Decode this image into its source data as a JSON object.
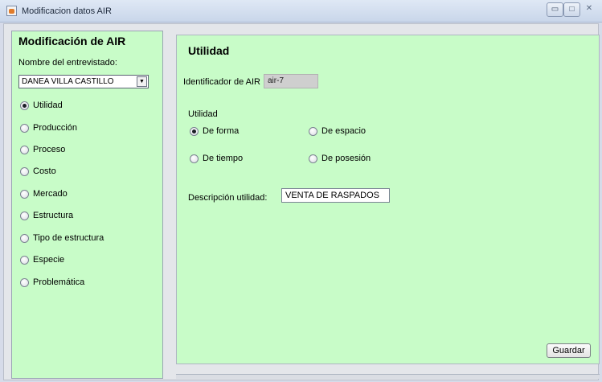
{
  "window": {
    "title": "Modificacion datos  AIR",
    "controls": {
      "minimize": "▭",
      "maximize": "□",
      "close": "✕"
    }
  },
  "left_panel": {
    "title": "Modificación de AIR",
    "interviewee_label": "Nombre del entrevistado:",
    "interviewee_selected": "DANEA VILLA CASTILLO",
    "combo_arrow": "▼",
    "options": [
      {
        "label": "Utilidad",
        "checked": true
      },
      {
        "label": "Producción",
        "checked": false
      },
      {
        "label": "Proceso",
        "checked": false
      },
      {
        "label": "Costo",
        "checked": false
      },
      {
        "label": "Mercado",
        "checked": false
      },
      {
        "label": "Estructura",
        "checked": false
      },
      {
        "label": "Tipo de estructura",
        "checked": false
      },
      {
        "label": "Especie",
        "checked": false
      },
      {
        "label": "Problemática",
        "checked": false
      }
    ]
  },
  "right_panel": {
    "title": "Utilidad",
    "air_id_label": "Identificador de AIR",
    "air_id_value": "air-7",
    "utility_group_label": "Utilidad",
    "utility_options": [
      {
        "label": "De forma",
        "checked": true
      },
      {
        "label": "De espacio",
        "checked": false
      },
      {
        "label": "De tiempo",
        "checked": false
      },
      {
        "label": "De posesión",
        "checked": false
      }
    ],
    "description_label": "Descripción utilidad:",
    "description_value": "VENTA DE RASPADOS",
    "save_label": "Guardar"
  },
  "colors": {
    "panel_background": "#c8fcc8",
    "window_background": "#e4e6ea"
  }
}
